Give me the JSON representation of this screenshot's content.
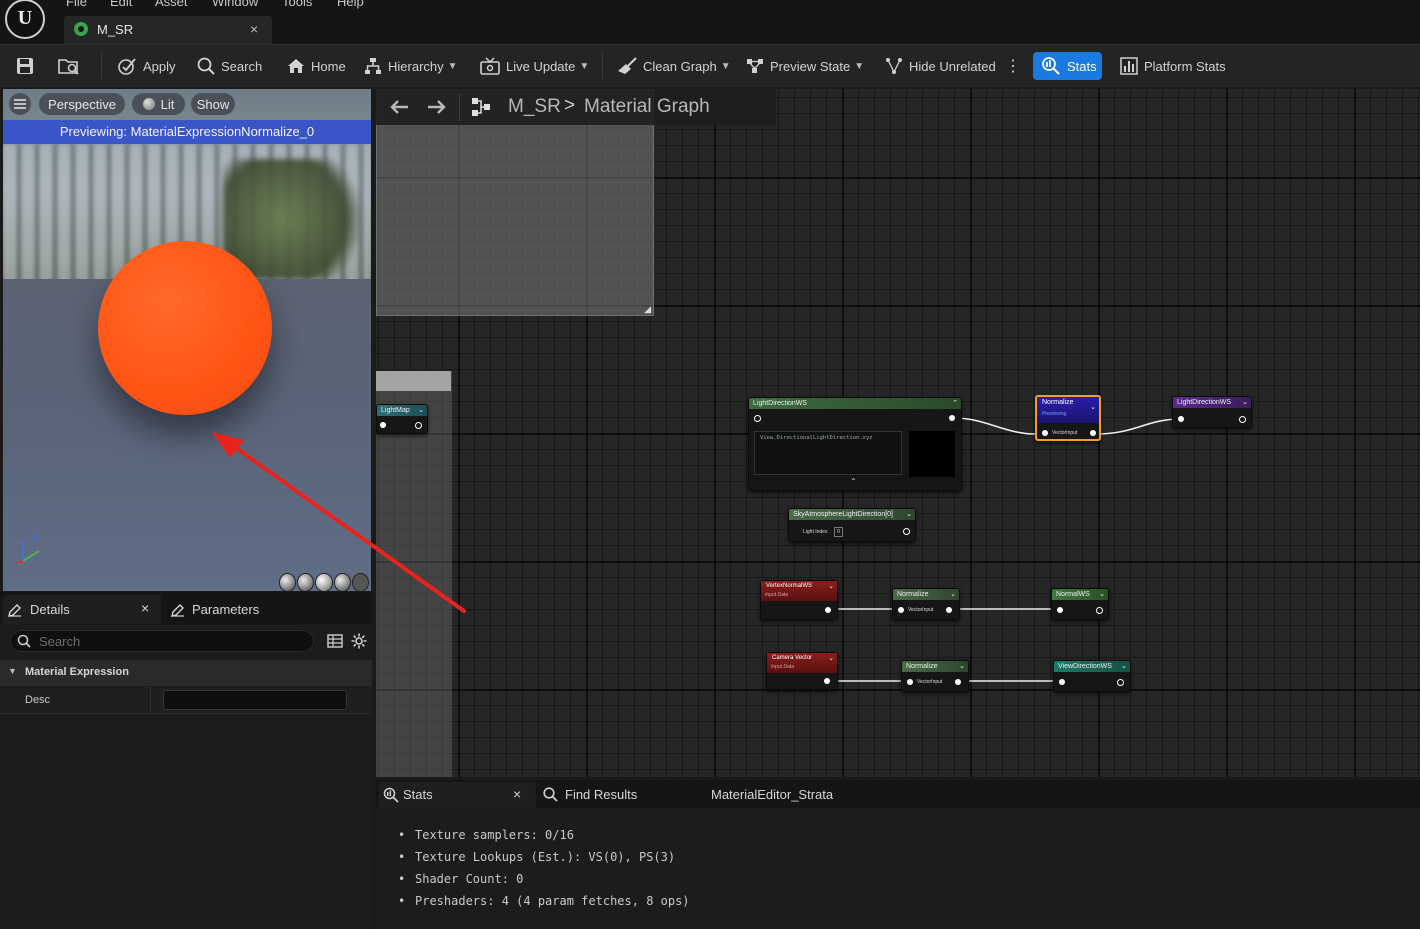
{
  "menu": [
    "File",
    "Edit",
    "Asset",
    "Window",
    "Tools",
    "Help"
  ],
  "document_tab": {
    "label": "M_SR",
    "close": "×"
  },
  "toolbar": {
    "apply": "Apply",
    "search": "Search",
    "home": "Home",
    "hierarchy": "Hierarchy",
    "live_update": "Live Update",
    "clean_graph": "Clean Graph",
    "preview_state": "Preview State",
    "hide_unrelated": "Hide Unrelated",
    "stats": "Stats",
    "platform_stats": "Platform Stats"
  },
  "viewport": {
    "perspective": "Perspective",
    "lit": "Lit",
    "show": "Show",
    "previewing": "Previewing: MaterialExpressionNormalize_0",
    "axis_z": "Z"
  },
  "details_panel": {
    "tab_details": "Details",
    "tab_close": "×",
    "tab_parameters": "Parameters",
    "search_placeholder": "Search",
    "category": "Material Expression",
    "desc_label": "Desc",
    "desc_value": ""
  },
  "graph": {
    "breadcrumb_root": "M_SR",
    "breadcrumb_separator": ">",
    "breadcrumb_current": "Material Graph",
    "nodes": {
      "lightmap": {
        "title": "LightMap"
      },
      "light_dir_custom": {
        "title": "LightDirectionWS",
        "code": "View.DirectionalLightDirection.xyz"
      },
      "normalize_main": {
        "title": "Normalize",
        "sub": "Previewing",
        "pin": "VectorInput"
      },
      "light_dir_out": {
        "title": "LightDirectionWS"
      },
      "sky_atmo": {
        "title": "SkyAtmosphereLightDirection[0]",
        "pin": "Light Index",
        "pin_value": "0"
      },
      "vertex_normal": {
        "title": "VertexNormalWS",
        "sub": "Input Data"
      },
      "normalize_2": {
        "title": "Normalize",
        "pin": "VectorInput"
      },
      "normal_ws": {
        "title": "NormalWS"
      },
      "camera_vector": {
        "title": "Camera Vector",
        "sub": "Input Data"
      },
      "normalize_3": {
        "title": "Normalize",
        "pin": "VectorInput"
      },
      "view_dir": {
        "title": "ViewDirectionWS"
      }
    }
  },
  "stats_panel": {
    "tab_stats": "Stats",
    "tab_close": "×",
    "tab_find": "Find Results",
    "tab_strata": "MaterialEditor_Strata",
    "lines": [
      "Texture samplers: 0/16",
      "Texture Lookups (Est.): VS(0), PS(3)",
      "Shader Count: 0",
      "Preshaders: 4  (4 param fetches, 8 ops)"
    ]
  },
  "colors": {
    "accent": "#1a7adf",
    "sphere": "#ff5414",
    "previewing_bar": "#3a55c8",
    "selection_outline": "#f0a020",
    "annotation_arrow": "#e8231e"
  }
}
